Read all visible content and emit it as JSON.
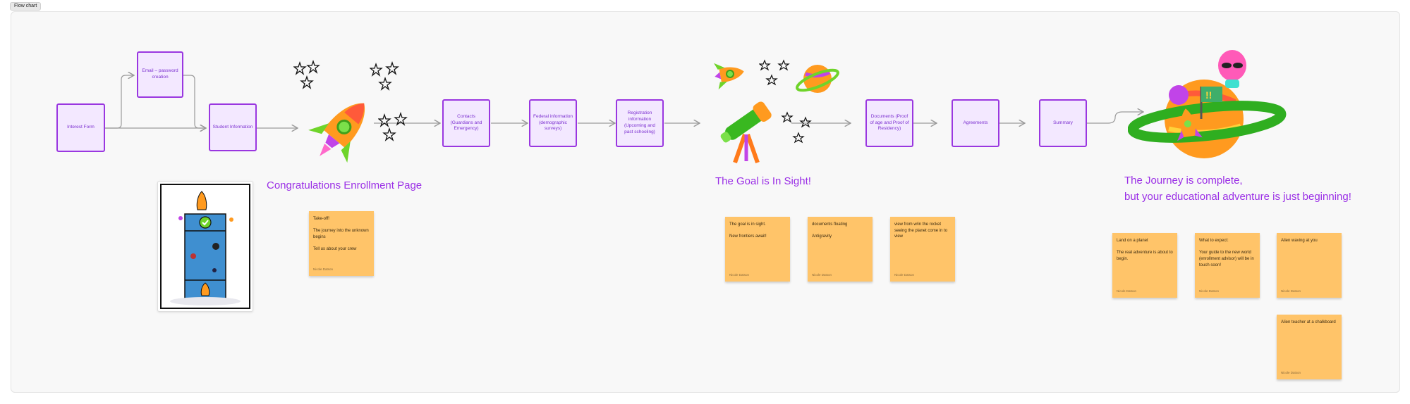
{
  "tab": {
    "label": "Flow chart"
  },
  "flow": {
    "interest_form": "Interest Form",
    "email_password": "Email – password creation",
    "student_info": "Student Information",
    "contacts": "Contacts (Guardians and Emergency)",
    "federal_info": "Federal information (demographic surveys)",
    "registration_info": "Registration information (Upcoming and past schooling)",
    "documents": "Documents (Proof of age and Proof of Residency)",
    "agreements": "Agreements",
    "summary": "Summary"
  },
  "headings": {
    "congrats": "Congratulations Enrollment Page",
    "goal": "The Goal is In Sight!",
    "journey_line1": "The Journey is complete,",
    "journey_line2": "but your educational adventure is just beginning!"
  },
  "stickies": {
    "takeoff": {
      "text": "Take-off!\n\nThe journey into the unknown begins\n\nTell us about your crew",
      "author": "Nicole Datson"
    },
    "goal": {
      "text": "The goal is in sight.\n\nNew frontiers await!",
      "author": "Nicole Datson"
    },
    "antigravity": {
      "text": "documents floating\n\nAntigravity",
      "author": "Nicole Datson"
    },
    "window": {
      "text": "view from w/in the rocket seeing the planet come in to view",
      "author": "Nicole Datson"
    },
    "land": {
      "text": "Land on a planet\n\nThe real adventure is about to begin.",
      "author": "Nicole Datson"
    },
    "expect": {
      "text": "What to expect:\n\nYour guide to the new world (enrollment advisor) will be in touch soon!",
      "author": "Nicole Datson"
    },
    "alien_waving": {
      "text": "Alien waving at you",
      "author": "Nicole Datson"
    },
    "alien_teacher": {
      "text": "Alien teacher at a chalkboard",
      "author": "Nicole Datson"
    }
  },
  "colors": {
    "box_border": "#9a37e0",
    "box_fill": "#f3e8ff",
    "heading": "#9a2ee6",
    "sticky": "#ffc469",
    "connector": "#9a9a9a"
  },
  "icons": [
    "rocket-icon",
    "stars-icon",
    "telescope-icon",
    "planet-icon",
    "alien-icon",
    "flag-icon",
    "phone-mockup-image"
  ]
}
